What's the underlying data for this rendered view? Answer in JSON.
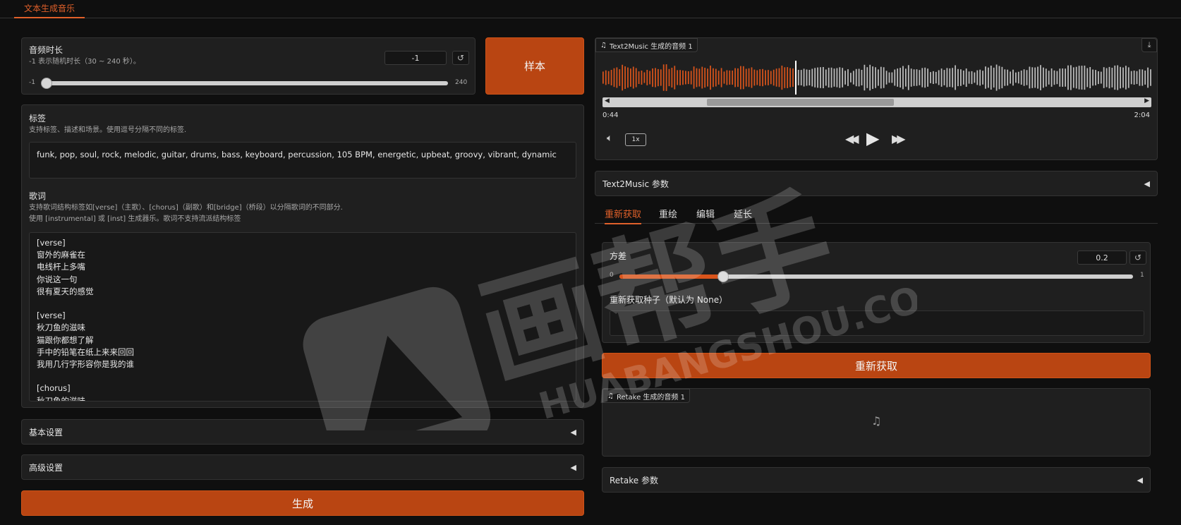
{
  "app_tab": "文本生成音乐",
  "duration": {
    "title": "音频时长",
    "hint": "-1 表示随机时长（30 ~ 240 秒）。",
    "value": "-1",
    "min_label": "-1",
    "max_label": "240",
    "slider_fraction": 0.0
  },
  "sample_button": "样本",
  "tags": {
    "title": "标签",
    "hint": "支持标签、描述和场景。使用逗号分隔不同的标签.",
    "value": "funk, pop, soul, rock, melodic, guitar, drums, bass, keyboard, percussion, 105 BPM, energetic, upbeat, groovy, vibrant, dynamic"
  },
  "lyrics": {
    "title": "歌词",
    "hint1": "支持歌词结构标签如[verse]（主歌）、[chorus]（副歌）和[bridge]（桥段）以分隔歌词的不同部分.",
    "hint2": "使用 [instrumental] 或 [inst] 生成器乐。歌词不支持流派结构标签",
    "lines": [
      "[verse]",
      "窗外的麻雀在",
      "电线杆上多嘴",
      "你说这一句",
      "很有夏天的感觉",
      "",
      "[verse]",
      "秋刀鱼的滋味",
      "猫跟你都想了解",
      "手中的铅笔在纸上来来回回",
      "我用几行字形容你是我的谁",
      "",
      "[chorus]",
      "秋刀鱼的滋味"
    ]
  },
  "basic_settings": "基本设置",
  "advanced_settings": "高级设置",
  "generate_button": "生成",
  "player": {
    "badge": "Text2Music 生成的音频 1",
    "current_time": "0:44",
    "total_time": "2:04",
    "speed": "1x",
    "progress_fraction": 0.35
  },
  "text2music_params": "Text2Music 参数",
  "subtabs": [
    "重新获取",
    "重绘",
    "编辑",
    "延长"
  ],
  "variance": {
    "title": "方差",
    "value": "0.2",
    "min_label": "0",
    "max_label": "1",
    "slider_fraction": 0.2
  },
  "retake_seed": {
    "title": "重新获取种子（默认为 None）",
    "value": ""
  },
  "retake_button": "重新获取",
  "retake_audio_badge": "Retake 生成的音频 1",
  "retake_params": "Retake 参数",
  "watermark": {
    "main": "画帮手",
    "sub": "HUABANGSHOU.COM"
  },
  "colors": {
    "accent": "#b94512",
    "played_wave": "#d9541b",
    "unplayed_wave": "#bdbdbd",
    "background": "#0f0f0f",
    "panel": "#1f1f1f"
  }
}
